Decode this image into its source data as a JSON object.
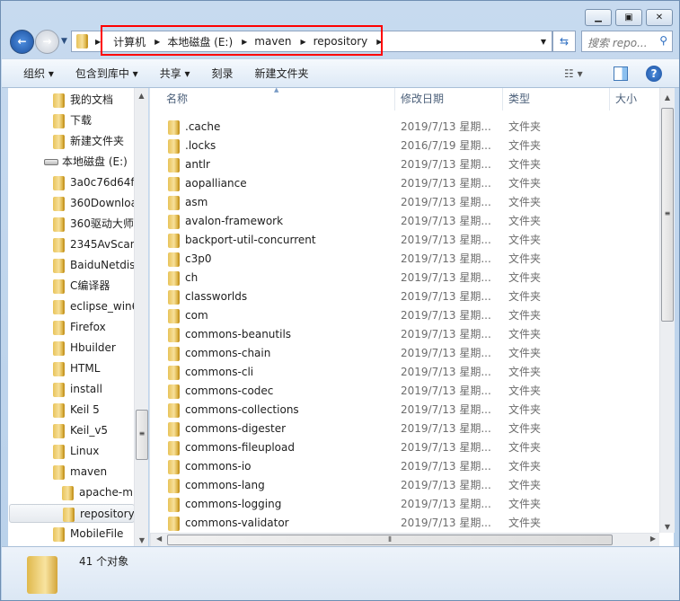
{
  "window": {
    "controls": [
      "minimize",
      "maximize",
      "close"
    ]
  },
  "address": {
    "crumbs": [
      "计算机",
      "本地磁盘 (E:)",
      "maven",
      "repository"
    ],
    "highlight_color": "#ff0000"
  },
  "search": {
    "placeholder": "搜索 repo..."
  },
  "toolbar": {
    "organize": "组织 ▾",
    "include_library": "包含到库中 ▾",
    "share": "共享 ▾",
    "burn": "刻录",
    "new_folder": "新建文件夹"
  },
  "tree": [
    {
      "label": "我的文档",
      "icon": "documents-icon",
      "level": 1
    },
    {
      "label": "下载",
      "icon": "downloads-icon",
      "level": 1
    },
    {
      "label": "新建文件夹",
      "icon": "folder-icon",
      "level": 1
    },
    {
      "label": "本地磁盘 (E:)",
      "icon": "drive-icon",
      "level": 0
    },
    {
      "label": "3a0c76d64f",
      "icon": "folder-icon",
      "level": 1
    },
    {
      "label": "360Downloa",
      "icon": "folder-icon",
      "level": 1
    },
    {
      "label": "360驱动大师",
      "icon": "folder-icon",
      "level": 1
    },
    {
      "label": "2345AvScan",
      "icon": "folder-icon",
      "level": 1
    },
    {
      "label": "BaiduNetdis",
      "icon": "folder-icon",
      "level": 1
    },
    {
      "label": "C编译器",
      "icon": "folder-icon",
      "level": 1
    },
    {
      "label": "eclipse_win6",
      "icon": "folder-icon",
      "level": 1
    },
    {
      "label": "Firefox",
      "icon": "folder-icon",
      "level": 1
    },
    {
      "label": "Hbuilder",
      "icon": "folder-icon",
      "level": 1
    },
    {
      "label": "HTML",
      "icon": "folder-icon",
      "level": 1
    },
    {
      "label": "install",
      "icon": "folder-icon",
      "level": 1
    },
    {
      "label": "Keil 5",
      "icon": "folder-icon",
      "level": 1
    },
    {
      "label": "Keil_v5",
      "icon": "folder-icon",
      "level": 1
    },
    {
      "label": "Linux",
      "icon": "folder-icon",
      "level": 1
    },
    {
      "label": "maven",
      "icon": "folder-icon",
      "level": 1
    },
    {
      "label": "apache-m",
      "icon": "folder-icon",
      "level": 2
    },
    {
      "label": "repository",
      "icon": "folder-icon",
      "level": 2,
      "selected": true
    },
    {
      "label": "MobileFile",
      "icon": "folder-icon",
      "level": 1
    }
  ],
  "columns": [
    "名称",
    "修改日期",
    "类型",
    "大小"
  ],
  "files": [
    {
      "name": ".cache",
      "date": "2019/7/13 星期...",
      "type": "文件夹"
    },
    {
      "name": ".locks",
      "date": "2016/7/19 星期...",
      "type": "文件夹"
    },
    {
      "name": "antlr",
      "date": "2019/7/13 星期...",
      "type": "文件夹"
    },
    {
      "name": "aopalliance",
      "date": "2019/7/13 星期...",
      "type": "文件夹"
    },
    {
      "name": "asm",
      "date": "2019/7/13 星期...",
      "type": "文件夹"
    },
    {
      "name": "avalon-framework",
      "date": "2019/7/13 星期...",
      "type": "文件夹"
    },
    {
      "name": "backport-util-concurrent",
      "date": "2019/7/13 星期...",
      "type": "文件夹"
    },
    {
      "name": "c3p0",
      "date": "2019/7/13 星期...",
      "type": "文件夹"
    },
    {
      "name": "ch",
      "date": "2019/7/13 星期...",
      "type": "文件夹"
    },
    {
      "name": "classworlds",
      "date": "2019/7/13 星期...",
      "type": "文件夹"
    },
    {
      "name": "com",
      "date": "2019/7/13 星期...",
      "type": "文件夹"
    },
    {
      "name": "commons-beanutils",
      "date": "2019/7/13 星期...",
      "type": "文件夹"
    },
    {
      "name": "commons-chain",
      "date": "2019/7/13 星期...",
      "type": "文件夹"
    },
    {
      "name": "commons-cli",
      "date": "2019/7/13 星期...",
      "type": "文件夹"
    },
    {
      "name": "commons-codec",
      "date": "2019/7/13 星期...",
      "type": "文件夹"
    },
    {
      "name": "commons-collections",
      "date": "2019/7/13 星期...",
      "type": "文件夹"
    },
    {
      "name": "commons-digester",
      "date": "2019/7/13 星期...",
      "type": "文件夹"
    },
    {
      "name": "commons-fileupload",
      "date": "2019/7/13 星期...",
      "type": "文件夹"
    },
    {
      "name": "commons-io",
      "date": "2019/7/13 星期...",
      "type": "文件夹"
    },
    {
      "name": "commons-lang",
      "date": "2019/7/13 星期...",
      "type": "文件夹"
    },
    {
      "name": "commons-logging",
      "date": "2019/7/13 星期...",
      "type": "文件夹"
    },
    {
      "name": "commons-validator",
      "date": "2019/7/13 星期...",
      "type": "文件夹"
    }
  ],
  "status": {
    "count": "41 个对象"
  }
}
